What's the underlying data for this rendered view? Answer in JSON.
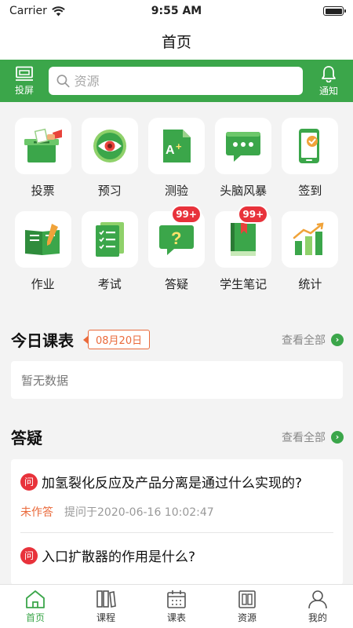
{
  "status_bar": {
    "carrier": "Carrier",
    "time": "9:55 AM"
  },
  "nav": {
    "title": "首页"
  },
  "toolbar": {
    "cast_label": "投屏",
    "search_placeholder": "资源",
    "notify_label": "通知"
  },
  "grid": {
    "items": [
      {
        "label": "投票",
        "icon": "ballot-box-icon"
      },
      {
        "label": "预习",
        "icon": "eye-icon"
      },
      {
        "label": "测验",
        "icon": "grade-doc-icon"
      },
      {
        "label": "头脑风暴",
        "icon": "chat-bubble-icon"
      },
      {
        "label": "签到",
        "icon": "phone-check-icon"
      },
      {
        "label": "作业",
        "icon": "homework-icon"
      },
      {
        "label": "考试",
        "icon": "exam-icon"
      },
      {
        "label": "答疑",
        "icon": "question-icon",
        "badge": "99+"
      },
      {
        "label": "学生笔记",
        "icon": "notebook-icon",
        "badge": "99+"
      },
      {
        "label": "统计",
        "icon": "bar-stats-icon"
      }
    ]
  },
  "schedule": {
    "title": "今日课表",
    "date": "08月20日",
    "view_all": "查看全部",
    "empty_text": "暂无数据"
  },
  "qa": {
    "title": "答疑",
    "view_all": "查看全部",
    "badge": "问",
    "items": [
      {
        "question": "加氢裂化反应及产品分离是通过什么实现的?",
        "status": "未作答",
        "time": "提问于2020-06-16 10:02:47"
      },
      {
        "question": "入口扩散器的作用是什么?"
      }
    ]
  },
  "tabs": [
    {
      "label": "首页",
      "active": true
    },
    {
      "label": "课程"
    },
    {
      "label": "课表"
    },
    {
      "label": "资源"
    },
    {
      "label": "我的"
    }
  ],
  "colors": {
    "brand_green": "#3ba64a",
    "badge_red": "#e8323b",
    "accent_orange": "#ea6a3b"
  }
}
